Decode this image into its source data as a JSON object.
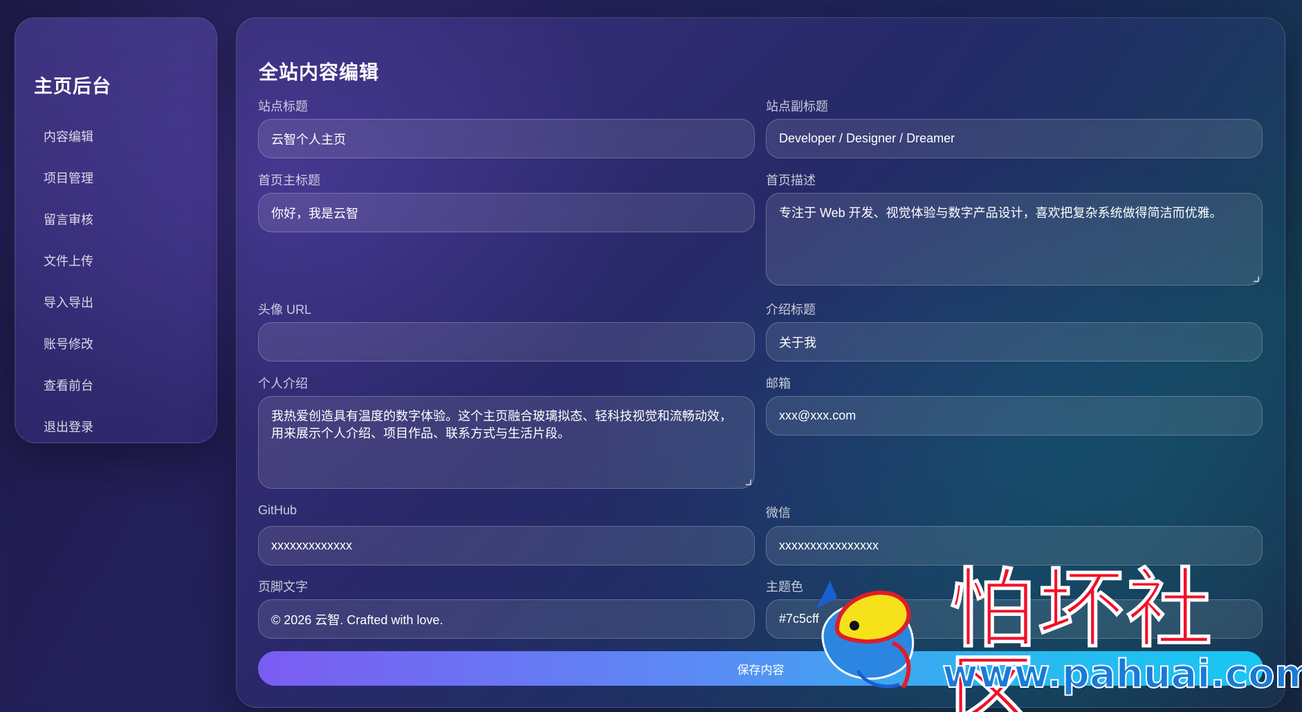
{
  "sidebar": {
    "title": "主页后台",
    "items": [
      "内容编辑",
      "项目管理",
      "留言审核",
      "文件上传",
      "导入导出",
      "账号修改",
      "查看前台",
      "退出登录"
    ]
  },
  "main": {
    "title": "全站内容编辑",
    "fields": {
      "site_title": {
        "label": "站点标题",
        "value": "云智个人主页"
      },
      "site_subtitle": {
        "label": "站点副标题",
        "value": "Developer / Designer / Dreamer"
      },
      "home_title": {
        "label": "首页主标题",
        "value": "你好，我是云智"
      },
      "home_desc": {
        "label": "首页描述",
        "value": "专注于 Web 开发、视觉体验与数字产品设计，喜欢把复杂系统做得简洁而优雅。"
      },
      "avatar_url": {
        "label": "头像 URL",
        "value": ""
      },
      "intro_title": {
        "label": "介绍标题",
        "value": "关于我"
      },
      "intro": {
        "label": "个人介绍",
        "value": "我热爱创造具有温度的数字体验。这个主页融合玻璃拟态、轻科技视觉和流畅动效，用来展示个人介绍、项目作品、联系方式与生活片段。"
      },
      "email": {
        "label": "邮箱",
        "value": "xxx@xxx.com"
      },
      "github": {
        "label": "GitHub",
        "value": "xxxxxxxxxxxxx"
      },
      "wechat": {
        "label": "微信",
        "value": "xxxxxxxxxxxxxxxx"
      },
      "footer": {
        "label": "页脚文字",
        "value": "© 2026 云智. Crafted with love."
      },
      "theme_color": {
        "label": "主题色",
        "value": "#7c5cff"
      }
    },
    "save_label": "保存内容"
  },
  "watermark": {
    "text": "怕坏社区",
    "url": "www.pahuai.com"
  },
  "colors": {
    "accent_start": "#7b5cf2",
    "accent_end": "#19c6f2",
    "watermark_red": "#f2102a",
    "watermark_blue": "#1a7ad8"
  }
}
